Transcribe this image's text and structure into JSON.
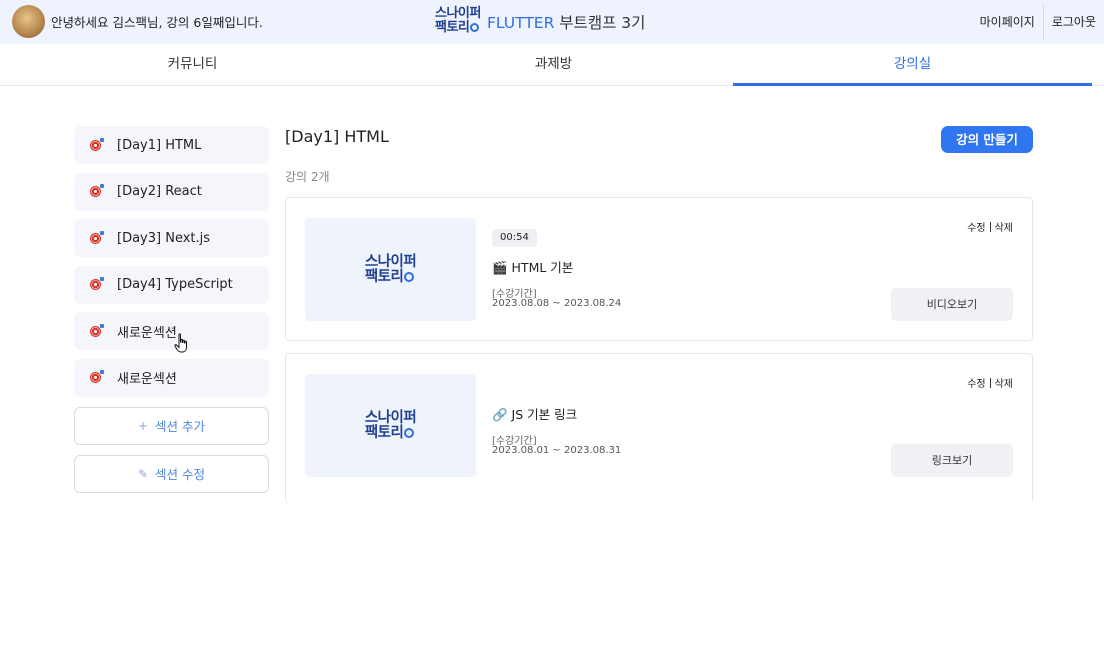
{
  "header": {
    "greeting": "안녕하세요 김스팩님, 강의 6일째입니다.",
    "logo_line1": "스나이퍼",
    "logo_line2": "팩토리",
    "brand_accent": "FLUTTER",
    "brand_rest": "부트캠프 3기",
    "mypage": "마이페이지",
    "logout": "로그아웃"
  },
  "tabs": [
    {
      "label": "커뮤니티",
      "active": false
    },
    {
      "label": "과제방",
      "active": false
    },
    {
      "label": "강의실",
      "active": true
    }
  ],
  "sidebar": {
    "sections": [
      {
        "label": "[Day1] HTML"
      },
      {
        "label": "[Day2] React"
      },
      {
        "label": "[Day3] Next.js"
      },
      {
        "label": "[Day4] TypeScript"
      },
      {
        "label": "새로운섹션"
      },
      {
        "label": "새로운섹션"
      }
    ],
    "add_section": "섹션 추가",
    "edit_section": "섹션 수정",
    "add_icon": "plus-icon",
    "edit_icon": "pencil-icon",
    "section_icon": "target-icon"
  },
  "main": {
    "title": "[Day1] HTML",
    "create_button": "강의 만들기",
    "count": "강의 2개",
    "lectures": [
      {
        "duration": "00:54",
        "title": "🎬 HTML 기본",
        "period_label": "[수강기간]",
        "period": "2023.08.08 ~ 2023.08.24",
        "edit": "수정",
        "delete": "삭제",
        "view_button": "비디오보기"
      },
      {
        "title": "🔗 JS 기본 링크",
        "period_label": "[수강기간]",
        "period": "2023.08.01 ~ 2023.08.31",
        "edit": "수정",
        "delete": "삭제",
        "view_button": "링크보기"
      }
    ]
  },
  "colors": {
    "accent": "#2f76f0",
    "header_bg": "#eef3fd",
    "sidebar_item_bg": "#f4f6fb"
  }
}
